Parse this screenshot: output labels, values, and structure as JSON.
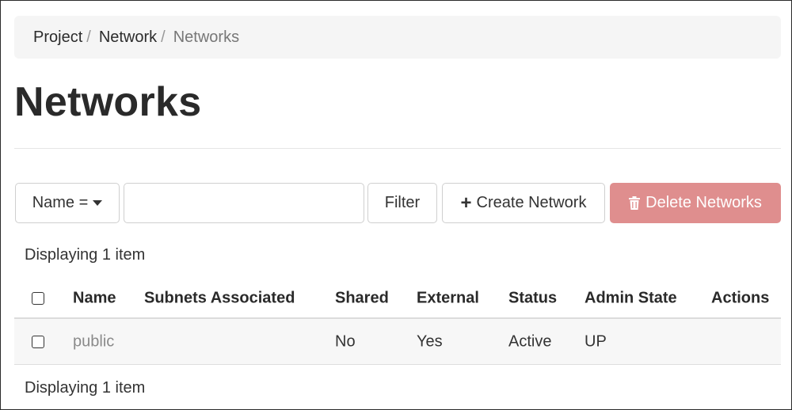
{
  "breadcrumb": {
    "items": [
      "Project",
      "Network",
      "Networks"
    ],
    "separator": "/"
  },
  "page": {
    "title": "Networks"
  },
  "toolbar": {
    "filter_field_label": "Name =",
    "filter_input_value": "",
    "filter_label": "Filter",
    "create_label": "Create Network",
    "delete_label": "Delete Networks",
    "delete_color": "#df8e8e"
  },
  "table": {
    "count_text_top": "Displaying 1 item",
    "count_text_bottom": "Displaying 1 item",
    "columns": [
      "Name",
      "Subnets Associated",
      "Shared",
      "External",
      "Status",
      "Admin State",
      "Actions"
    ],
    "rows": [
      {
        "name": "public",
        "subnets": "",
        "shared": "No",
        "external": "Yes",
        "status": "Active",
        "admin_state": "UP",
        "actions": ""
      }
    ]
  },
  "icons": {
    "create": "plus-icon",
    "delete": "trash-icon",
    "dropdown": "caret-down-icon"
  }
}
